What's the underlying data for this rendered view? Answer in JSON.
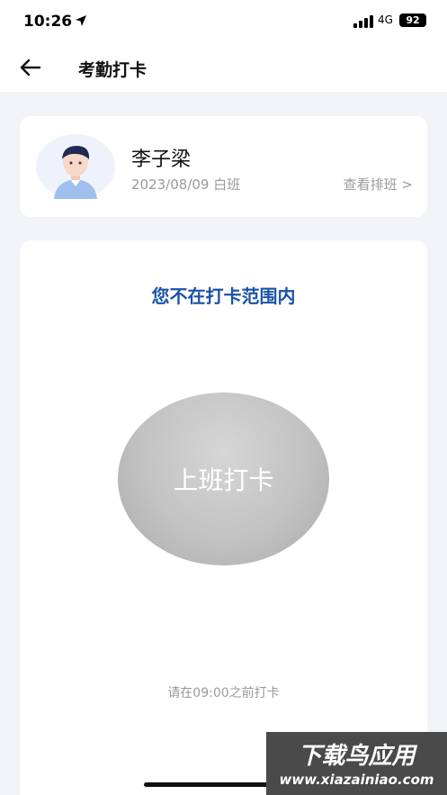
{
  "status_bar": {
    "time": "10:26",
    "network": "4G",
    "battery": "92"
  },
  "nav": {
    "title": "考勤打卡"
  },
  "profile": {
    "name": "李子梁",
    "shift": "2023/08/09 白班",
    "schedule_link": "查看排班 >"
  },
  "attendance": {
    "range_status": "您不在打卡范围内",
    "punch_label": "上班打卡",
    "hint": "请在09:00之前打卡"
  },
  "watermark": {
    "line1": "下载鸟应用",
    "line2": "www.xiazainiao.com"
  },
  "colors": {
    "accent": "#1b53a6",
    "button_gray": "#c2c2c2",
    "muted_text": "#9a9a9a",
    "background": "#f2f3f7"
  }
}
